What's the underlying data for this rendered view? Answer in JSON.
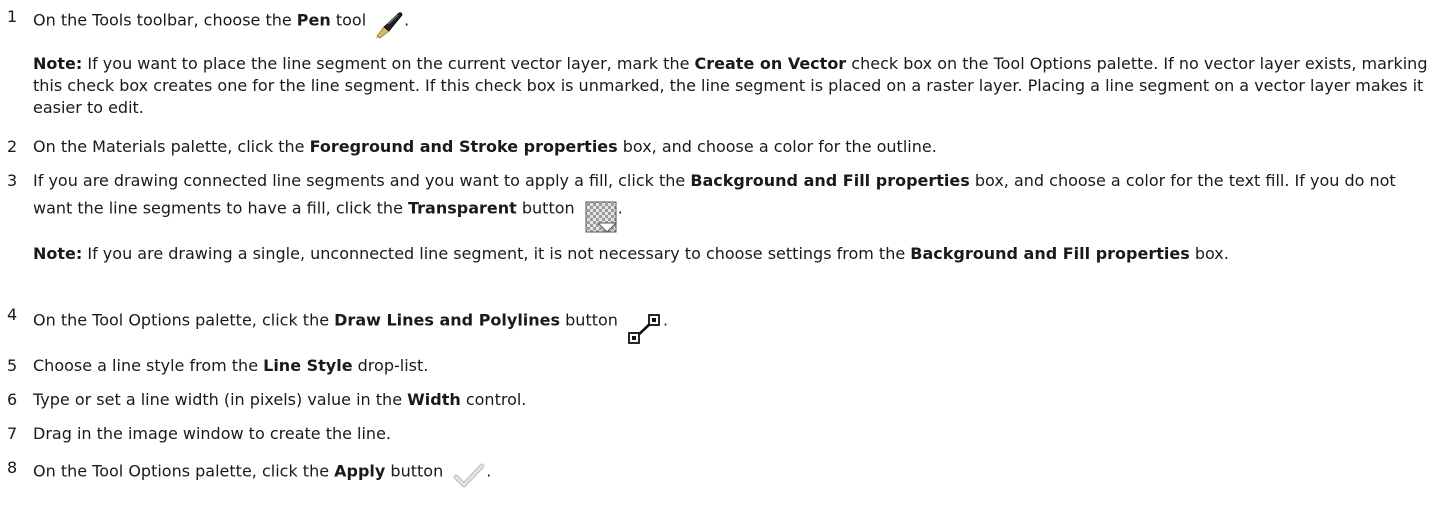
{
  "steps": [
    {
      "num": "1",
      "parts": [
        "On the Tools toolbar, choose the ",
        "Pen",
        " tool",
        "."
      ],
      "icon": "pen-icon",
      "note": {
        "lead": "Note:",
        "parts": [
          " If you want to place the line segment on the current vector layer, mark the ",
          "Create on Vector",
          " check box on the Tool Options palette.  If no vector layer exists, marking this check box creates one for the line segment. If this check box is unmarked, the line segment is placed on a raster layer. Placing a line segment on a vector layer makes it easier to edit."
        ]
      }
    },
    {
      "num": "2",
      "parts": [
        "On the Materials palette, click the ",
        "Foreground and Stroke properties",
        " box, and choose a color for the outline."
      ]
    },
    {
      "num": "3",
      "parts": [
        "If you are drawing connected line segments and you want to apply a fill, click the ",
        "Background and Fill  properties",
        " box, and choose a color for the text fill. If you do not want the line segments to have a fill, click the ",
        "Transparent",
        " button ",
        "."
      ],
      "icon": "transparent-icon",
      "note": {
        "lead": "Note:",
        "parts": [
          " If you are drawing a single, unconnected line segment, it is not necessary to choose settings from the ",
          "Background and Fill properties",
          " box."
        ]
      }
    },
    {
      "num": "4",
      "parts": [
        "On the Tool Options palette, click the ",
        "Draw Lines and Polylines",
        " button ",
        "."
      ],
      "icon": "draw-lines-icon"
    },
    {
      "num": "5",
      "parts": [
        "Choose a line style from the ",
        "Line Style",
        " drop-list."
      ]
    },
    {
      "num": "6",
      "parts": [
        "Type or set a line width (in pixels) value in the ",
        "Width",
        " control."
      ]
    },
    {
      "num": "7",
      "parts": [
        "Drag in the image window to create the line."
      ]
    },
    {
      "num": "8",
      "parts": [
        "On the Tool Options palette, click the ",
        "Apply",
        " button ",
        "."
      ],
      "icon": "apply-checkmark-icon"
    }
  ]
}
